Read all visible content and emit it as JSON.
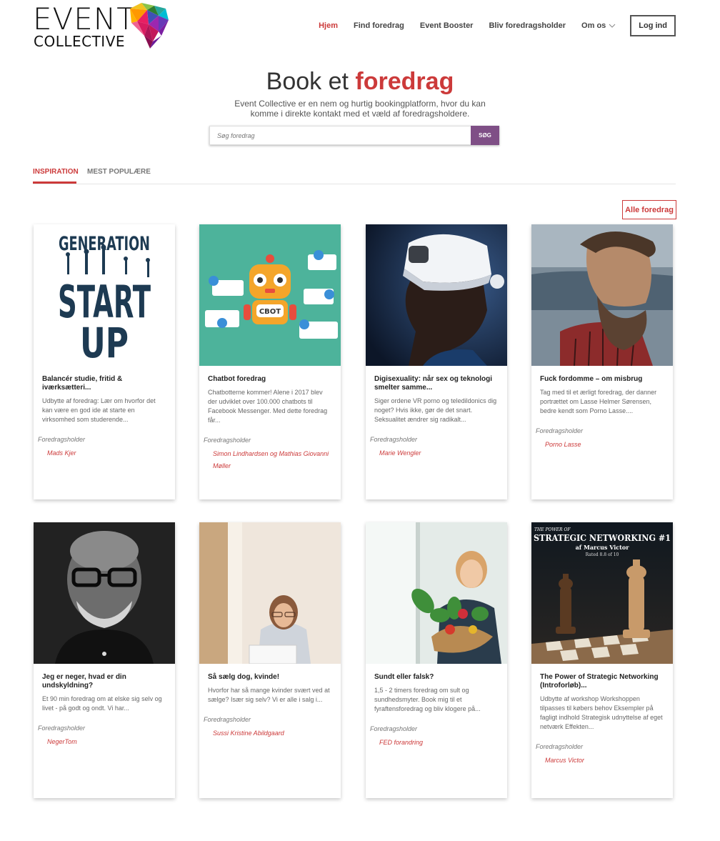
{
  "brand": {
    "line1": "EVENT",
    "line2": "COLLECTIVE"
  },
  "nav": {
    "items": [
      "Hjem",
      "Find foredrag",
      "Event Booster",
      "Bliv foredragsholder",
      "Om os"
    ],
    "login": "Log ind"
  },
  "hero": {
    "title_plain": "Book et",
    "title_accent": "foredrag",
    "subtitle_line1": "Event Collective er en nem og hurtig bookingplatform, hvor du kan",
    "subtitle_line2": "komme i direkte kontakt med et væld af foredragsholdere."
  },
  "search": {
    "placeholder": "Søg foredrag",
    "button": "SØG"
  },
  "tabs": [
    "INSPIRATION",
    "MEST POPULÆRE"
  ],
  "all_button": "Alle foredrag",
  "speaker_label": "Foredragsholder",
  "cards": [
    {
      "title": "Balancér studie, fritid & iværksætteri...",
      "desc": "Udbytte af foredrag: Lær om hvorfor det kan være en god ide at starte en virksomhed som studerende...",
      "speaker": "Mads Kjer",
      "image_text": [
        "GENERATION",
        "START",
        "UP"
      ]
    },
    {
      "title": "Chatbot foredrag",
      "desc": "Chatbotterne kommer! Alene i 2017 blev der udviklet over 100.000 chatbots til Facebook Messenger. Med dette foredrag får...",
      "speaker": "Simon Lindhardsen og Mathias Giovanni Møller",
      "image_text": [
        "CBOT"
      ]
    },
    {
      "title": "Digisexuality: når sex og teknologi smelter samme...",
      "desc": "Siger ordene VR porno og teledildonics dig noget? Hvis ikke, gør de det snart. Seksualitet ændrer sig radikalt...",
      "speaker": "Marie Wengler"
    },
    {
      "title": "Fuck fordomme – om misbrug",
      "desc": "Tag med til et ærligt foredrag, der danner portrættet om Lasse Helmer Sørensen, bedre kendt som Porno Lasse....",
      "speaker": "Porno Lasse"
    },
    {
      "title": "Jeg er neger, hvad er din undskyldning?",
      "desc": "Et 90 min foredrag om at elske sig selv og livet - på godt og ondt. Vi har...",
      "speaker": "NegerTom"
    },
    {
      "title": "Så sælg dog, kvinde!",
      "desc": "Hvorfor har så mange kvinder svært ved at sælge? Især sig selv? Vi er alle i salg i...",
      "speaker": "Sussi Kristine Abildgaard"
    },
    {
      "title": "Sundt eller falsk?",
      "desc": "1,5 - 2 timers foredrag om sult og sundhedsmyter. Book mig til et fyraftensforedrag og bliv klogere på...",
      "speaker": "FED forandring"
    },
    {
      "title": "The Power of Strategic Networking (Introforløb)...",
      "desc": "Udbytte af workshop Workshoppen tilpasses til købers behov Eksempler på fagligt indhold Strategisk udnyttelse af eget netværk Effekten...",
      "speaker": "Marcus Victor",
      "image_text": [
        "THE POWER OF",
        "STRATEGIC NETWORKING #1",
        "af Marcus Victor",
        "Rated 8.8 of 10"
      ]
    }
  ],
  "colors": {
    "accent": "#cc3a3a",
    "search_button": "#7f4f86"
  }
}
